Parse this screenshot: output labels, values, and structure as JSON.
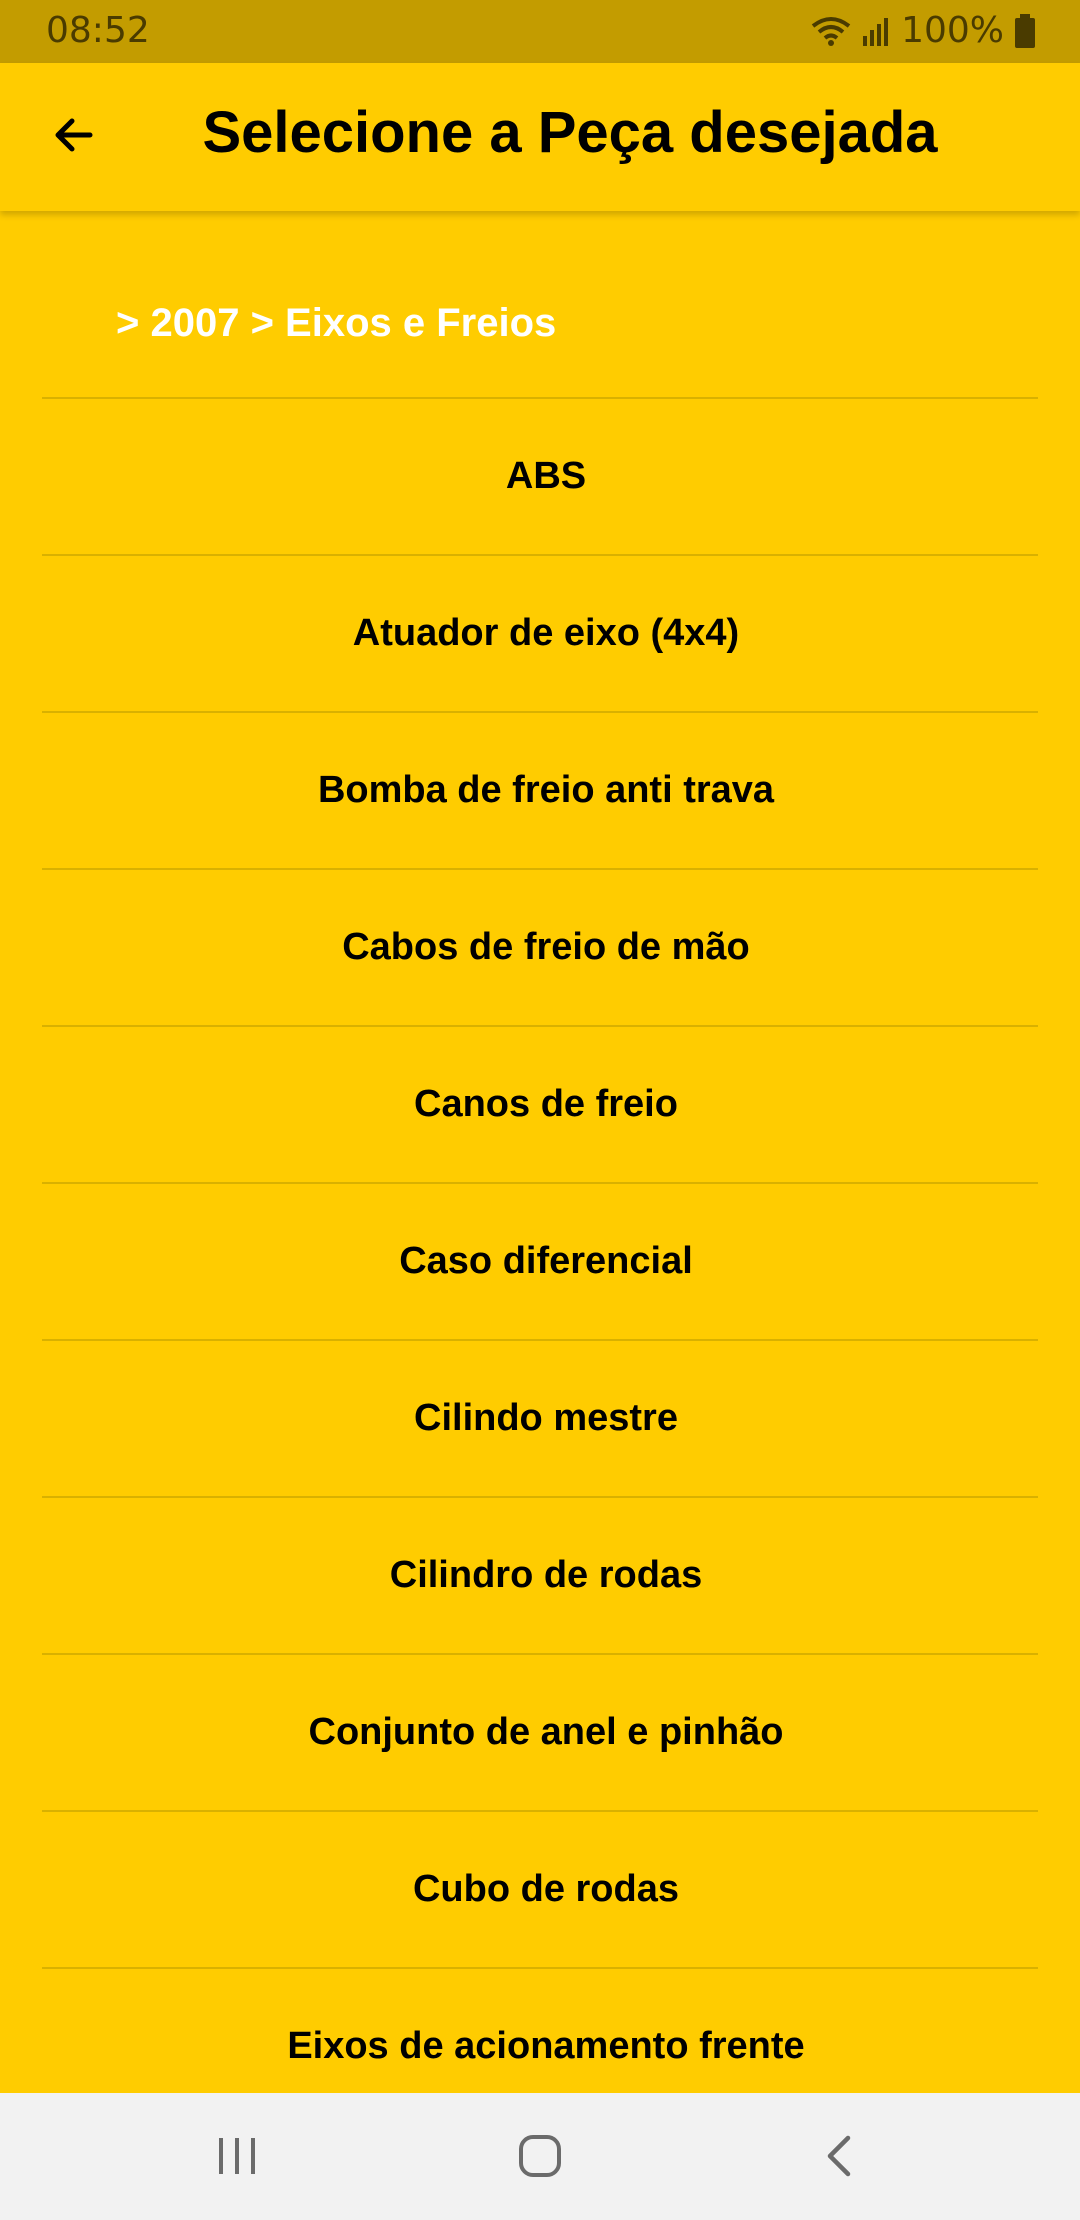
{
  "status": {
    "time": "08:52",
    "battery": "100%",
    "icons": [
      "wifi-icon",
      "signal-icon",
      "battery-icon"
    ]
  },
  "app_bar": {
    "title": "Selecione a Peça desejada",
    "back_icon": "arrow-left-icon"
  },
  "breadcrumb": "> 2007 > Eixos e Freios",
  "list": {
    "items": [
      "ABS",
      "Atuador de eixo (4x4)",
      "Bomba de freio anti trava",
      "Cabos de freio de mão",
      "Canos de freio",
      "Caso diferencial",
      "Cilindo mestre",
      "Cilindro de rodas",
      "Conjunto de anel e pinhão",
      "Cubo de rodas",
      "Eixos de acionamento frente"
    ]
  },
  "colors": {
    "background": "#ffcc00",
    "status_bar": "#c39c00",
    "divider": "#d9b100",
    "breadcrumb_text": "#ffffff",
    "nav_bar": "#f2f2f2"
  },
  "nav": {
    "icons": [
      "recent-apps-icon",
      "home-icon",
      "back-icon"
    ]
  }
}
